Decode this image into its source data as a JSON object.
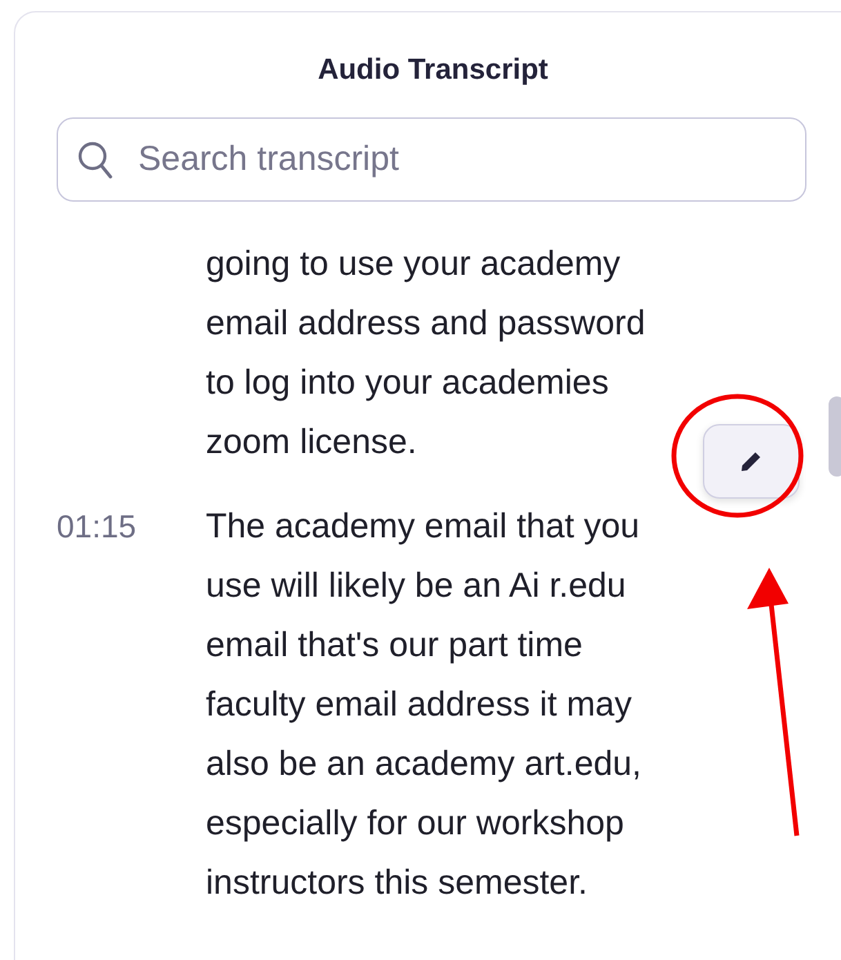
{
  "panel": {
    "title": "Audio Transcript"
  },
  "search": {
    "placeholder": "Search transcript"
  },
  "segments": [
    {
      "text": "going to use your academy email address and password to log into your academies zoom license."
    },
    {
      "time": "01:15",
      "text": "The academy email that you use will likely be an Ai r.edu email that's our part time faculty email address it may also be an academy art.edu, especially for our workshop instructors this semester."
    }
  ]
}
